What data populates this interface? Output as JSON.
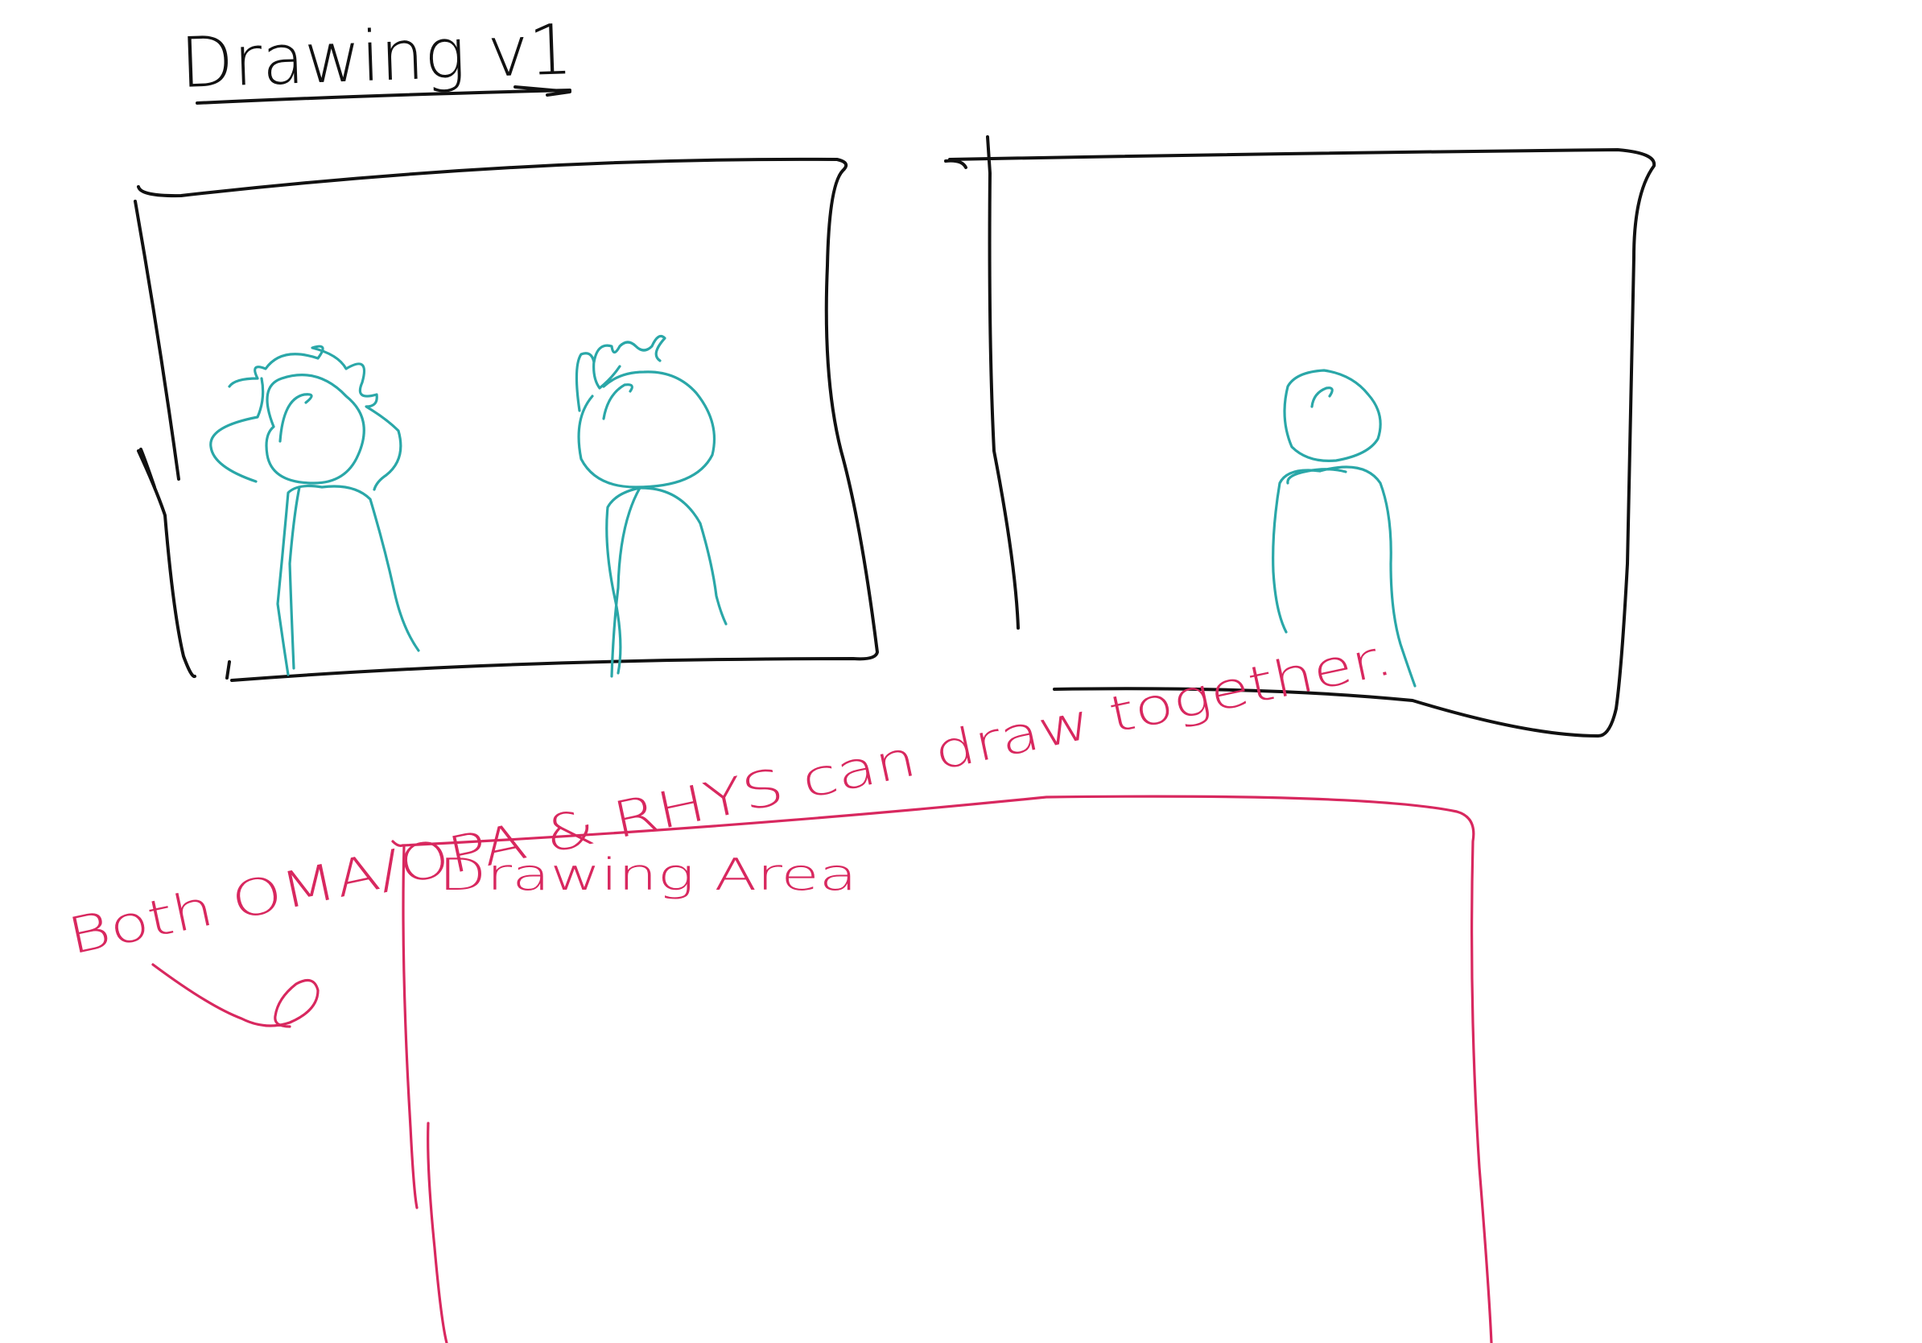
{
  "sketch": {
    "title": "Drawing v1",
    "note": "Both OMA/OPA & RHYS can draw together.",
    "area_label": "Drawing Area"
  },
  "colors": {
    "ink": "#111111",
    "figures": "#2aa7a8",
    "annotation": "#d8285f",
    "paper": "#ffffff"
  }
}
